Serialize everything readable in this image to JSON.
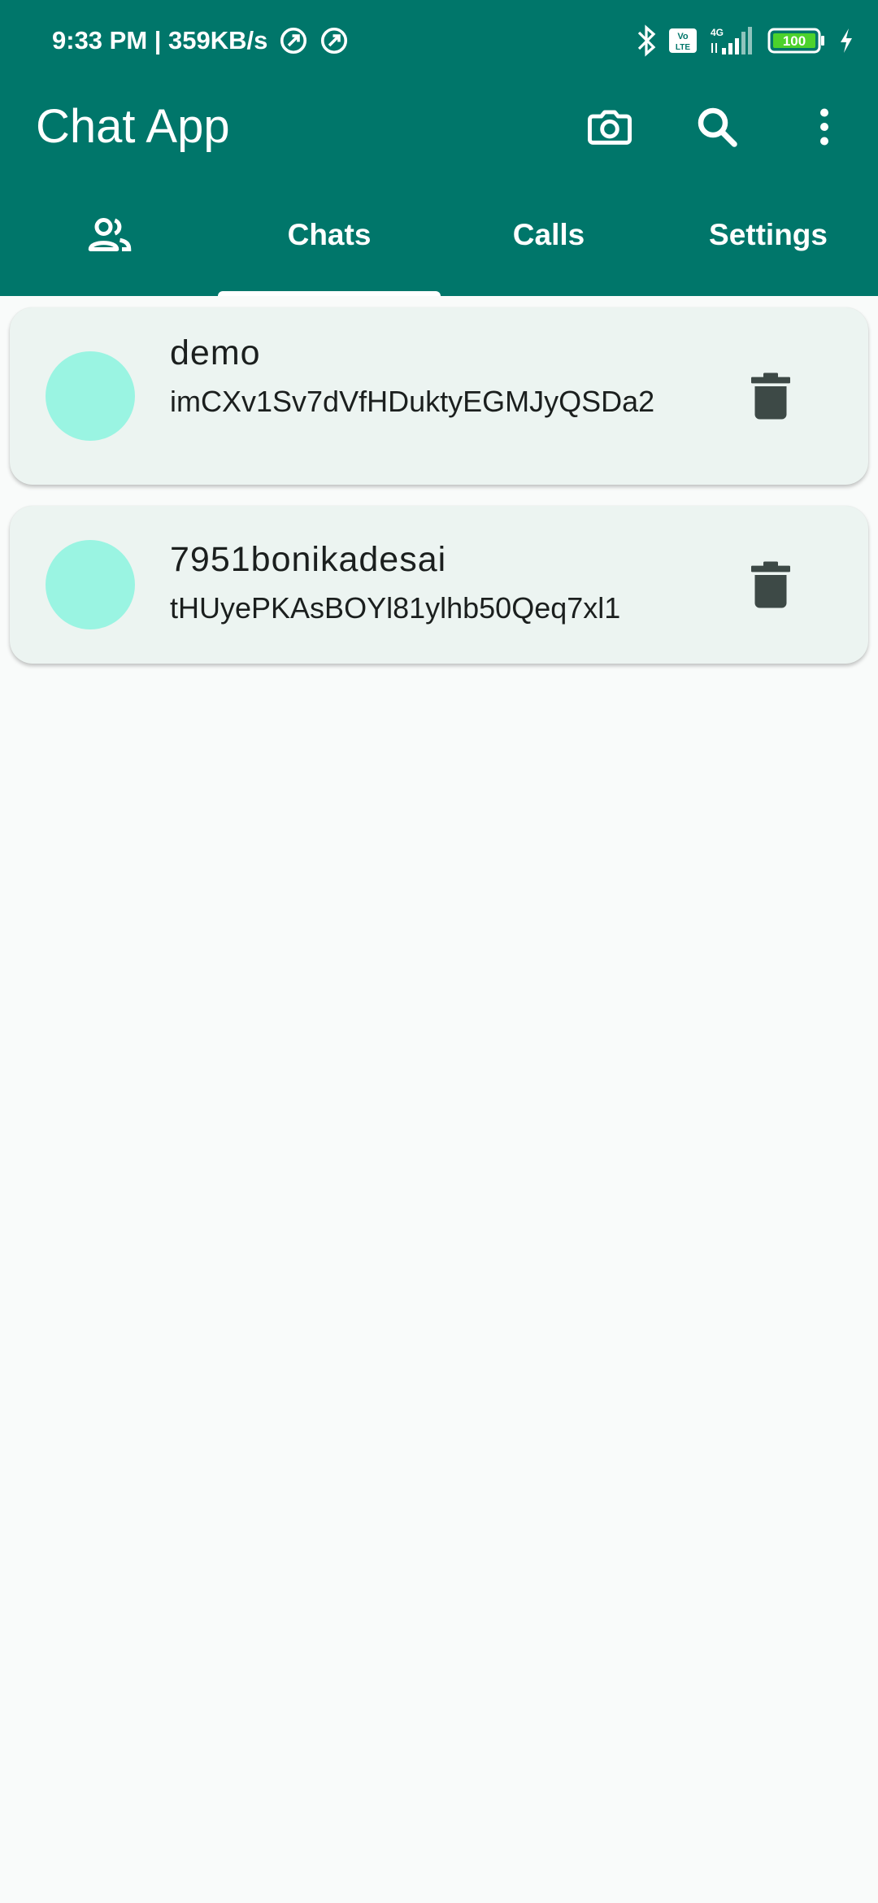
{
  "status_bar": {
    "time_speed": "9:33 PM | 359KB/s",
    "network": "4G",
    "volte": "Vo LTE",
    "battery": "100"
  },
  "toolbar": {
    "title": "Chat App",
    "camera_icon": "camera-icon",
    "search_icon": "search-icon",
    "more_icon": "more-vert-icon"
  },
  "tabs": [
    {
      "label": "",
      "icon": "group-icon"
    },
    {
      "label": "Chats",
      "selected": true
    },
    {
      "label": "Calls"
    },
    {
      "label": "Settings"
    }
  ],
  "chats": [
    {
      "name": "demo",
      "id": "imCXv1Sv7dVfHDuktyEGMJyQSDa2"
    },
    {
      "name": "7951bonikadesai",
      "id": "tHUyePKAsBOYl81ylhb50Qeq7xl1"
    }
  ],
  "colors": {
    "primary": "#00766a",
    "avatar": "#9af4e2",
    "card": "#ecf4f1",
    "background": "#f9fbfa",
    "icon_dark": "#3d4946"
  }
}
